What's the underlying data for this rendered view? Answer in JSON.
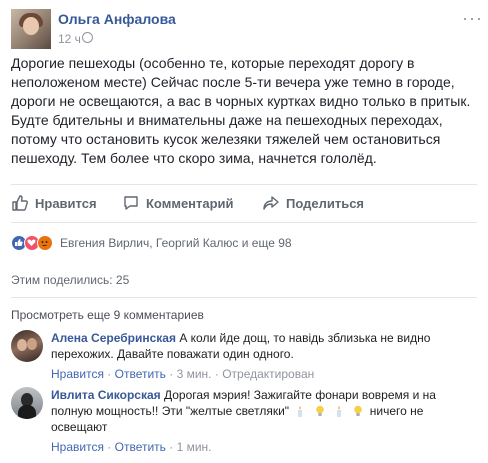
{
  "post": {
    "author": "Ольга Анфалова",
    "time": "12 ч",
    "text": "Дорогие пешеходы (особенно те, которые переходят дорогу в неположеном месте) Сейчас после 5-ти вечера уже темно в городе, дороги не освещаются, а вас в чорных куртках видно только в притык. Будте бдительны и внимательны даже на пешеходных переходах, потому что остановить кусок железяки тяжелей чем остановиться пешеходу. Тем более что скоро зима, начнется гололёд."
  },
  "actions": {
    "like": "Нравится",
    "comment": "Комментарий",
    "share": "Поделиться"
  },
  "reactions": {
    "icons": [
      "like-icon",
      "love-icon",
      "angry-icon"
    ],
    "names": "Евгения Вирлич, Георгий Калюс и еще 98"
  },
  "shares": "Этим поделились: 25",
  "view_more": "Просмотреть еще 9 комментариев",
  "comments": [
    {
      "name": "Алена Серебринская",
      "text": "А коли йде дощ, то навідь зблизька не видно перехожих. Давайте поважати один одного.",
      "like": "Нравится",
      "reply": "Ответить",
      "time": "3 мин.",
      "edited": "Отредактирован"
    },
    {
      "name": "Ивлита Сикорская",
      "text": "Дорогая мэрия! Зажигайте фонари вовремя и на полную мощность!! Эти \"желтые светляки\"",
      "text_after": "ничего не освещают",
      "like": "Нравится",
      "reply": "Ответить",
      "time": "1 мин."
    }
  ],
  "colors": {
    "link": "#365899",
    "secondary": "#90949c",
    "like_blue": "#4267b2"
  }
}
